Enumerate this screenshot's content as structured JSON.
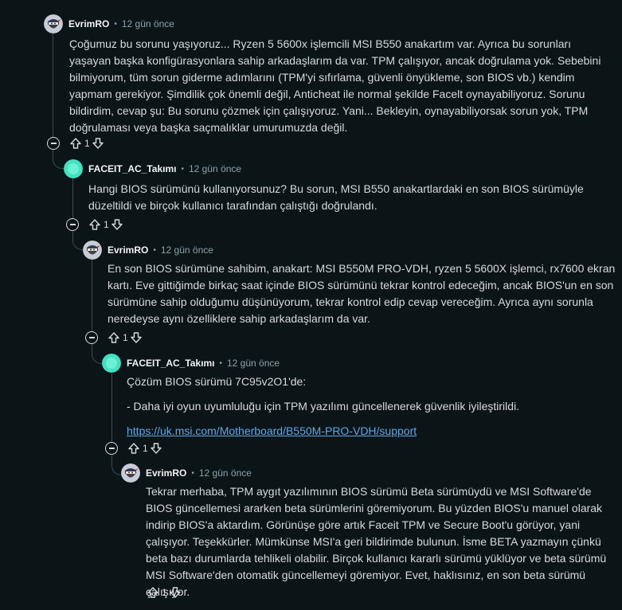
{
  "comments": [
    {
      "author": "EvrimRO",
      "time": "12 gün önce",
      "paragraphs": [
        "Çoğumuz bu sorunu yaşıyoruz... Ryzen 5 5600x işlemcili MSI B550 anakartım var. Ayrıca bu sorunları yaşayan başka konfigürasyonlara sahip arkadaşlarım da var. TPM çalışıyor, ancak doğrulama yok. Sebebini bilmiyorum, tüm sorun giderme adımlarını (TPM'yi sıfırlama, güvenli önyükleme, son BIOS vb.) kendim yapmam gerekiyor. Şimdilik çok önemli değil, Anticheat ile normal şekilde Facelt oynayabiliyoruz. Sorunu bildirdim, cevap şu: Bu sorunu çözmek için çalışıyoruz. Yani... Bekleyin, oynayabiliyorsak sorun yok, TPM doğrulaması veya başka saçmalıklar umurumuzda değil."
      ],
      "votes": "1"
    },
    {
      "author": "FACEIT_AC_Takımı",
      "time": "12 gün önce",
      "paragraphs": [
        "Hangi BIOS sürümünü kullanıyorsunuz? Bu sorun, MSI B550 anakartlardaki en son BIOS sürümüyle düzeltildi ve birçok kullanıcı tarafından çalıştığı doğrulandı."
      ],
      "votes": "1"
    },
    {
      "author": "EvrimRO",
      "time": "12 gün önce",
      "paragraphs": [
        "En son BIOS sürümüne sahibim, anakart: MSI B550M PRO-VDH, ryzen 5 5600X işlemci, rx7600 ekran kartı. Eve gittiğimde birkaç saat içinde BIOS sürümünü tekrar kontrol edeceğim, ancak BIOS'un en son sürümüne sahip olduğumu düşünüyorum, tekrar kontrol edip cevap vereceğim. Ayrıca aynı sorunla neredeyse aynı özelliklere sahip arkadaşlarım da var."
      ],
      "votes": "1"
    },
    {
      "author": "FACEIT_AC_Takımı",
      "time": "12 gün önce",
      "paragraphs": [
        "Çözüm BIOS sürümü 7C95v2O1'de:",
        "- Daha iyi oyun uyumluluğu için TPM yazılımı güncellenerek güvenlik iyileştirildi."
      ],
      "link": "https://uk.msi.com/Motherboard/B550M-PRO-VDH/support",
      "votes": "1"
    },
    {
      "author": "EvrimRO",
      "time": "12 gün önce",
      "paragraphs": [
        "Tekrar merhaba, TPM aygıt yazılımının BIOS sürümü Beta sürümüydü ve MSI Software'de BIOS güncellemesi ararken beta sürümlerini göremiyorum. Bu yüzden BIOS'u manuel olarak indirip BIOS'a aktardım. Görünüşe göre artık Faceit TPM ve Secure Boot'u görüyor, yani çalışıyor. Teşekkürler. Mümkünse MSI'a geri bildirimde bulunun. İsme BETA yazmayın çünkü beta bazı durumlarda tehlikeli olabilir. Birçok kullanıcı kararlı sürümü yüklüyor ve beta sürümü MSI Software'den otomatik güncellemeyi göremiyor. Evet, haklısınız, en son beta sürümü çalışıyor."
      ],
      "votes": "1"
    }
  ],
  "separator": "•",
  "icons": {
    "upvote": "upvote-arrow-icon",
    "downvote": "downvote-arrow-icon",
    "collapse": "collapse-minus-icon",
    "avatar_user": "ninja-avatar-icon",
    "avatar_faceit": "faceit-avatar-icon"
  },
  "colors": {
    "background": "#0b1416",
    "text": "#d7dadc",
    "meta": "#8ba2ad",
    "link": "#5fa8e6",
    "faceit_avatar": "#3fe3c0"
  }
}
